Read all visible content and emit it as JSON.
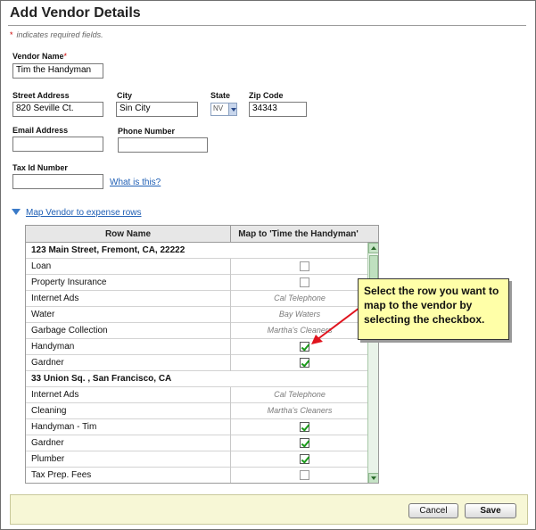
{
  "page": {
    "title": "Add Vendor Details",
    "required_note_star": "*",
    "required_note": "indicates required fields."
  },
  "form": {
    "vendor_name": {
      "label": "Vendor Name",
      "required_star": "*",
      "value": "Tim the Handyman"
    },
    "street_address": {
      "label": "Street Address",
      "value": "820 Seville Ct."
    },
    "city": {
      "label": "City",
      "value": "Sin City"
    },
    "state": {
      "label": "State",
      "value": "NV"
    },
    "zip_code": {
      "label": "Zip Code",
      "value": "34343"
    },
    "email": {
      "label": "Email Address",
      "value": ""
    },
    "phone": {
      "label": "Phone Number",
      "value": ""
    },
    "tax_id": {
      "label": "Tax Id Number",
      "value": "",
      "help_link": "What is this?"
    }
  },
  "mapping": {
    "toggle_label": "Map Vendor to expense rows",
    "columns": [
      "Row Name",
      "Map to 'Time the Handyman'"
    ],
    "rows": [
      {
        "name": "123 Main Street, Fremont, CA, 22222",
        "group": true
      },
      {
        "name": "Loan",
        "checked": false
      },
      {
        "name": "Property Insurance",
        "checked": false
      },
      {
        "name": "Internet Ads",
        "mapped_to": "Cal Telephone"
      },
      {
        "name": "Water",
        "mapped_to": "Bay Waters"
      },
      {
        "name": "Garbage Collection",
        "mapped_to": "Martha's Cleaners"
      },
      {
        "name": "Handyman",
        "checked": true
      },
      {
        "name": "Gardner",
        "checked": true
      },
      {
        "name": "33 Union Sq. , San Francisco, CA",
        "group": true
      },
      {
        "name": "Internet Ads",
        "mapped_to": "Cal Telephone"
      },
      {
        "name": "Cleaning",
        "mapped_to": "Martha's Cleaners"
      },
      {
        "name": "Handyman - Tim",
        "checked": true
      },
      {
        "name": "Gardner",
        "checked": true
      },
      {
        "name": "Plumber",
        "checked": true
      },
      {
        "name": "Tax Prep. Fees",
        "checked": false
      }
    ]
  },
  "callout": {
    "text": "Select the row you want to map to the vendor by selecting the checkbox."
  },
  "footer": {
    "cancel_label": "Cancel",
    "save_label": "Save"
  },
  "colors": {
    "link": "#1f5fb5",
    "required": "#cc0000",
    "check": "#1a9a1a",
    "callout_bg": "#ffffa8",
    "footer_bg": "#f7f7d6"
  }
}
